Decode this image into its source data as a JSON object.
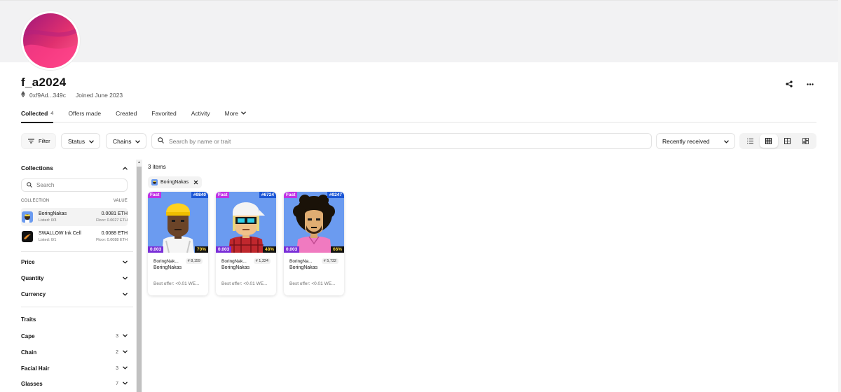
{
  "profile": {
    "username": "f_a2024",
    "address": "0xf9Ad...349c",
    "joined": "Joined June 2023"
  },
  "tabs": [
    {
      "label": "Collected",
      "count": "4"
    },
    {
      "label": "Offers made"
    },
    {
      "label": "Created"
    },
    {
      "label": "Favorited"
    },
    {
      "label": "Activity"
    },
    {
      "label": "More"
    }
  ],
  "toolbar": {
    "filter_label": "Filter",
    "status_label": "Status",
    "chains_label": "Chains",
    "search_placeholder": "Search by name or trait",
    "sort_label": "Recently received"
  },
  "sidebar": {
    "collections_title": "Collections",
    "search_placeholder": "Search",
    "col_collection": "COLLECTION",
    "col_value": "VALUE",
    "collections": [
      {
        "name": "BoringNakas",
        "listed": "Listed: 0/3",
        "value": "0.0081 ETH",
        "floor": "Floor: 0.0027 ETH"
      },
      {
        "name": "SWALLOW Ink Cell",
        "listed": "Listed: 0/1",
        "value": "0.0088 ETH",
        "floor": "Floor: 0.0088 ETH"
      }
    ],
    "filters": [
      "Price",
      "Quantity",
      "Currency"
    ],
    "traits_title": "Traits",
    "traits": [
      {
        "name": "Cape",
        "count": "3"
      },
      {
        "name": "Chain",
        "count": "2"
      },
      {
        "name": "Facial Hair",
        "count": "3"
      },
      {
        "name": "Glasses",
        "count": "7"
      }
    ]
  },
  "results": {
    "count_label": "3 items",
    "chip_label": "BoringNakas"
  },
  "cards": [
    {
      "fast": "Fast",
      "id": "#9840",
      "price": "0.003",
      "pct": "70%",
      "name": "BoringNak...",
      "rank": "# 8,159",
      "collection": "BoringNakas",
      "offer": "Best offer: <0.01 WE..."
    },
    {
      "fast": "Fast",
      "id": "#6724",
      "price": "0.003",
      "pct": "48%",
      "name": "BoringNak...",
      "rank": "# 1,324",
      "collection": "BoringNakas",
      "offer": "Best offer: <0.01 WE..."
    },
    {
      "fast": "Fast",
      "id": "#9247",
      "price": "0.003",
      "pct": "66%",
      "name": "BoringNa...",
      "rank": "# 5,732",
      "collection": "BoringNakas",
      "offer": "Best offer: <0.01 WE..."
    }
  ],
  "colors": {
    "avatar_gradient_start": "#c2185b",
    "avatar_gradient_end": "#ff4f9a",
    "card_bg": "#6b9bf0",
    "fast_badge": "#c132e6",
    "id_badge": "#1b56d6",
    "price_badge": "#7a2fd8",
    "pct_text": "#ffd93a"
  },
  "icons": [
    "ethereum-icon",
    "share-icon",
    "more-icon",
    "filter-icon",
    "chevron-down-icon",
    "search-icon",
    "list-view-icon",
    "grid-view-icon",
    "large-grid-view-icon",
    "mosaic-view-icon",
    "chevron-up-icon",
    "close-icon"
  ]
}
